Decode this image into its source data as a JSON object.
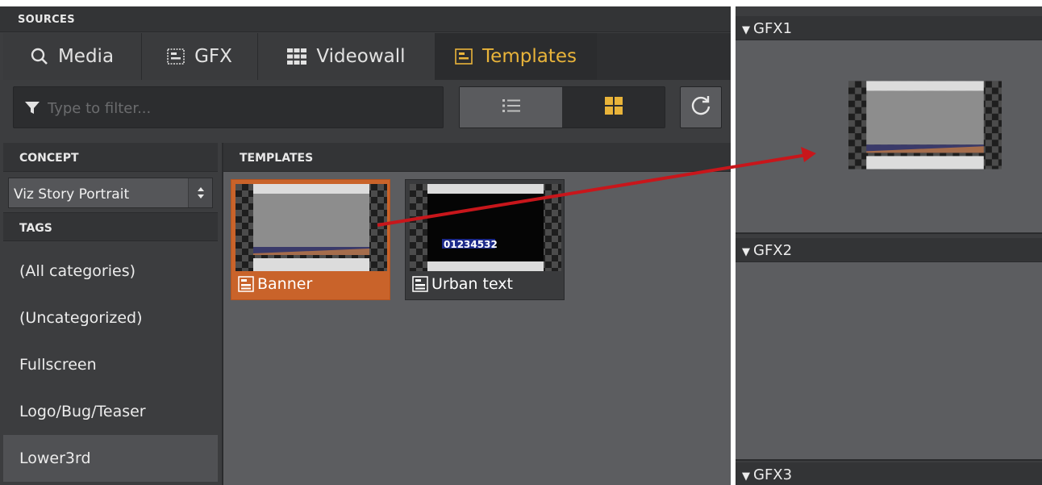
{
  "sources": {
    "title": "SOURCES"
  },
  "tabs": [
    {
      "label": "Media",
      "icon": "search-icon",
      "active": false
    },
    {
      "label": "GFX",
      "icon": "gfx-icon",
      "active": false
    },
    {
      "label": "Videowall",
      "icon": "videowall-icon",
      "active": false
    },
    {
      "label": "Templates",
      "icon": "templates-icon",
      "active": true
    }
  ],
  "filter": {
    "placeholder": "Type to filter...",
    "value": ""
  },
  "view": {
    "mode": "grid",
    "active_color": "#e9b43a"
  },
  "concept": {
    "header": "CONCEPT",
    "selected": "Viz Story Portrait"
  },
  "tags": {
    "header": "TAGS",
    "items": [
      "(All categories)",
      "(Uncategorized)",
      "Fullscreen",
      "Logo/Bug/Teaser",
      "Lower3rd"
    ],
    "selected": "Lower3rd"
  },
  "templates": {
    "header": "TEMPLATES",
    "items": [
      {
        "label": "Banner",
        "selected": true,
        "thumb_text": ""
      },
      {
        "label": "Urban text",
        "selected": false,
        "thumb_text": "01234532"
      }
    ]
  },
  "gfx": {
    "channels": [
      {
        "label": "GFX1",
        "expanded": true
      },
      {
        "label": "GFX2",
        "expanded": true
      },
      {
        "label": "GFX3",
        "expanded": true
      }
    ]
  },
  "colors": {
    "accent": "#e9b43a",
    "selection": "#c9632a",
    "arrow": "#c8161b"
  }
}
